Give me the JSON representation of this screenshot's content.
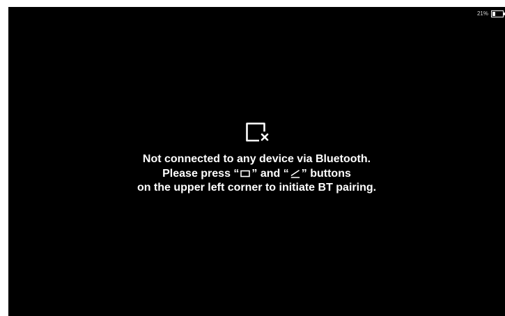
{
  "status_bar": {
    "battery_percent": "21%",
    "battery_icon": "battery-icon"
  },
  "main": {
    "status_icon": "display-disconnected-icon",
    "message": {
      "line1": "Not connected to any device via Bluetooth.",
      "line2_prefix": "Please press “",
      "line2_middle": "” and “",
      "line2_suffix": "” buttons",
      "line3": "on the upper left corner to initiate BT pairing.",
      "button_icons": [
        "square-button-icon",
        "pen-button-icon"
      ]
    }
  },
  "colors": {
    "background": "#000000",
    "text": "#ffffff"
  }
}
